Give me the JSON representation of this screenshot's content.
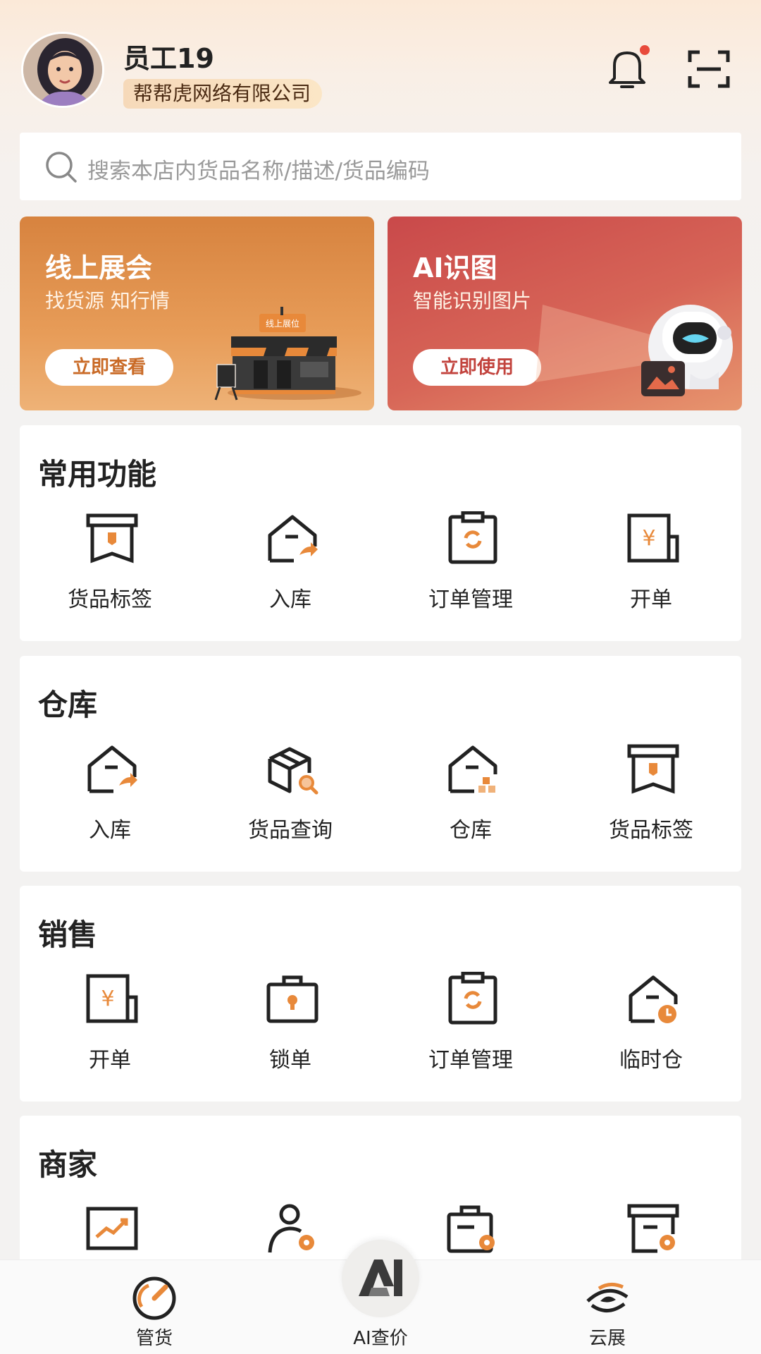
{
  "user": {
    "name": "员工19",
    "company": "帮帮虎网络有限公司"
  },
  "search": {
    "placeholder": "搜索本店内货品名称/描述/货品编码"
  },
  "banners": [
    {
      "title": "线上展会",
      "subtitle": "找货源 知行情",
      "button": "立即查看",
      "sign_text": "线上展位"
    },
    {
      "title": "AI识图",
      "subtitle": "智能识别图片",
      "button": "立即使用"
    }
  ],
  "sections": [
    {
      "title": "常用功能",
      "items": [
        {
          "label": "货品标签",
          "icon": "label-box-icon"
        },
        {
          "label": "入库",
          "icon": "warehouse-in-icon"
        },
        {
          "label": "订单管理",
          "icon": "order-clipboard-icon"
        },
        {
          "label": "开单",
          "icon": "bill-yen-icon"
        }
      ]
    },
    {
      "title": "仓库",
      "items": [
        {
          "label": "入库",
          "icon": "warehouse-in-icon"
        },
        {
          "label": "货品查询",
          "icon": "package-search-icon"
        },
        {
          "label": "仓库",
          "icon": "warehouse-icon"
        },
        {
          "label": "货品标签",
          "icon": "label-box-icon"
        }
      ]
    },
    {
      "title": "销售",
      "items": [
        {
          "label": "开单",
          "icon": "bill-yen-icon"
        },
        {
          "label": "锁单",
          "icon": "lock-bag-icon"
        },
        {
          "label": "订单管理",
          "icon": "order-clipboard-icon"
        },
        {
          "label": "临时仓",
          "icon": "temp-warehouse-icon"
        }
      ]
    },
    {
      "title": "商家",
      "items": [
        {
          "icon": "merchant-chart-icon"
        },
        {
          "icon": "merchant-user-settings-icon"
        },
        {
          "icon": "merchant-bag-settings-icon"
        },
        {
          "icon": "merchant-store-settings-icon"
        }
      ]
    }
  ],
  "tabbar": [
    {
      "label": "管货",
      "icon": "gauge-icon"
    },
    {
      "label": "AI查价",
      "icon": "ai-logo-icon"
    },
    {
      "label": "云展",
      "icon": "eye-logo-icon"
    }
  ],
  "colors": {
    "accent": "#e8893a",
    "notification_dot": "#e84a3b",
    "banner_orange": "#d7833f",
    "banner_red": "#c9494a"
  }
}
